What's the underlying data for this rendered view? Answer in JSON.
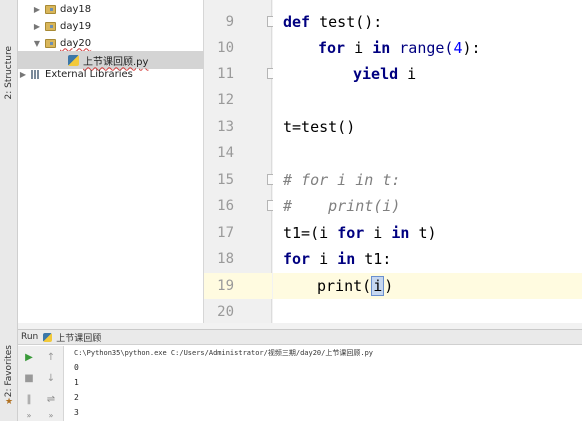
{
  "left_strip": {
    "structure_label": "2: Structure",
    "favorites_label": "2: Favorites"
  },
  "project_tree": {
    "items": [
      {
        "label": "day18",
        "expanded": false
      },
      {
        "label": "day19",
        "expanded": false
      },
      {
        "label": "day20",
        "expanded": true
      },
      {
        "label": "上节课回顾.py",
        "selected": true
      },
      {
        "label": "External Libraries",
        "expanded": false
      }
    ]
  },
  "editor": {
    "line_numbers": [
      "9",
      "10",
      "11",
      "12",
      "13",
      "14",
      "15",
      "16",
      "17",
      "18",
      "19",
      "20"
    ],
    "current_line": "19",
    "lines": {
      "l9": {
        "kw": "def",
        "rest": " test():"
      },
      "l10": {
        "kw1": "for",
        "mid1": " i ",
        "kw2": "in",
        "builtin": " range(",
        "num": "4",
        "end": "):"
      },
      "l11": {
        "kw": "yield",
        "rest": " i"
      },
      "l13": {
        "text": "t=test()"
      },
      "l15": {
        "text": "# for i in t:"
      },
      "l16": {
        "text": "#    print(i)"
      },
      "l17": {
        "a": "t1=(i ",
        "kw1": "for",
        "b": " i ",
        "kw2": "in",
        "c": " t)"
      },
      "l18": {
        "kw1": "for",
        "b": " i ",
        "kw2": "in",
        "c": " t1:"
      },
      "l19": {
        "a": "print(",
        "sel": "i",
        "c": ")"
      }
    }
  },
  "run_panel": {
    "title": "Run",
    "config_name": "上节课回顾",
    "command": "C:\\Python35\\python.exe C:/Users/Administrator/视频三期/day20/上节课回顾.py",
    "output": [
      "0",
      "1",
      "2",
      "3"
    ]
  },
  "colors": {
    "keyword": "#000080",
    "number": "#0000ff",
    "comment": "#808080",
    "current_line": "#fffbe0"
  }
}
